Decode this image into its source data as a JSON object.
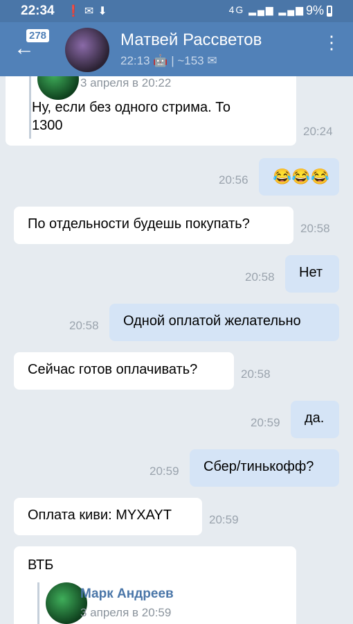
{
  "status": {
    "time": "22:34",
    "signal_text": "4G",
    "battery": "9%"
  },
  "header": {
    "badge": "278",
    "contact_name": "Матвей Рассветов",
    "last_seen": "22:13",
    "separator": "|",
    "messages_count": "~153"
  },
  "messages": {
    "m0": {
      "fwd_date": "3 апреля в 20:22",
      "text_line1": "Ну, если без одного стрима. То",
      "text_line2": "1300",
      "time": "20:24"
    },
    "m1": {
      "text": "😂😂😂",
      "time": "20:56"
    },
    "m2": {
      "text": "По отдельности будешь покупать?",
      "time": "20:58"
    },
    "m3": {
      "text": "Нет",
      "time": "20:58"
    },
    "m4": {
      "text": "Одной оплатой желательно",
      "time": "20:58"
    },
    "m5": {
      "text": "Сейчас готов оплачивать?",
      "time": "20:58"
    },
    "m6": {
      "text": "да.",
      "time": "20:59"
    },
    "m7": {
      "text": "Сбер/тинькофф?",
      "time": "20:59"
    },
    "m8": {
      "text": "Оплата киви: MYXAYT",
      "time": "20:59"
    },
    "m9": {
      "text": "ВТБ",
      "fwd_name": "Марк Андреев",
      "fwd_date": "3 апреля в 20:59"
    }
  }
}
